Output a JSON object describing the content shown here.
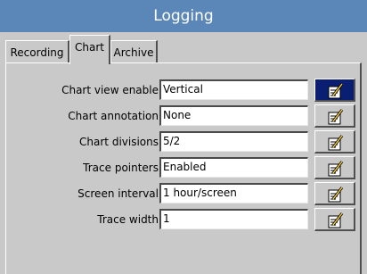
{
  "window": {
    "title": "Logging"
  },
  "tabs": [
    {
      "label": "Recording",
      "active": false
    },
    {
      "label": "Chart",
      "active": true
    },
    {
      "label": "Archive",
      "active": false
    }
  ],
  "settings": [
    {
      "label": "Chart view enable",
      "value": "Vertical",
      "selected": true,
      "icon": "edit-icon"
    },
    {
      "label": "Chart annotation",
      "value": "None",
      "selected": false,
      "icon": "edit-icon"
    },
    {
      "label": "Chart divisions",
      "value": "5/2",
      "selected": false,
      "icon": "edit-icon"
    },
    {
      "label": "Trace pointers",
      "value": "Enabled",
      "selected": false,
      "icon": "edit-icon"
    },
    {
      "label": "Screen interval",
      "value": "1 hour/screen",
      "selected": false,
      "icon": "edit-icon"
    },
    {
      "label": "Trace width",
      "value": "1",
      "selected": false,
      "icon": "edit-icon"
    }
  ],
  "colors": {
    "title_bar": "#5b87b8",
    "background": "#c9c9c9",
    "selected_button": "#0a1f72"
  }
}
